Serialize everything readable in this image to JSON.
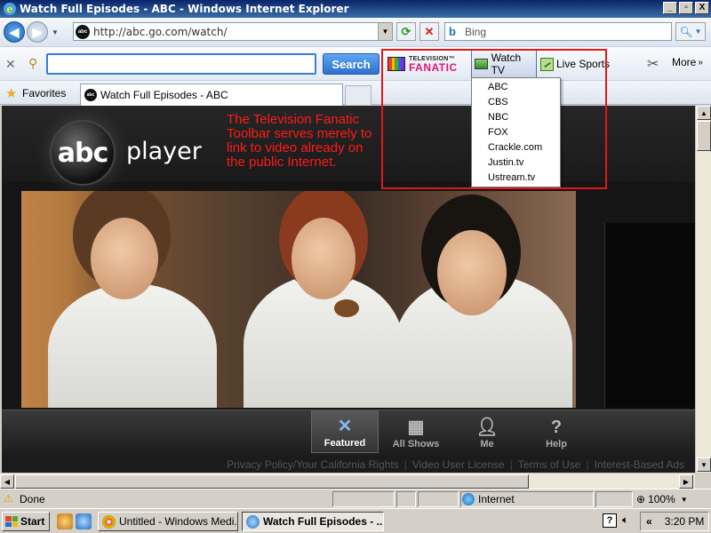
{
  "window": {
    "title": "Watch Full Episodes - ABC - Windows Internet Explorer",
    "minimize": "_",
    "maximize": "▫",
    "close": "X"
  },
  "address_bar": {
    "url": "http://abc.go.com/watch/",
    "site_icon_text": "abc",
    "search_placeholder": "Bing"
  },
  "toolbar": {
    "search_button": "Search",
    "logo_top": "TELEVISION™",
    "logo_bottom": "FANATIC",
    "watch_tv": "Watch TV",
    "live_sports": "Live Sports",
    "more": "More"
  },
  "watch_tv_menu": {
    "items": [
      "ABC",
      "CBS",
      "NBC",
      "FOX",
      "Crackle.com",
      "Justin.tv",
      "Ustream.tv"
    ]
  },
  "favorites_bar": {
    "favorites_label": "Favorites",
    "tab_title": "Watch Full Episodes - ABC"
  },
  "page": {
    "logo_text": "abc",
    "player_text": "player",
    "annotation": "The Television Fanatic Toolbar serves merely to link to video already on the public Internet.",
    "nav": [
      "Featured",
      "All Shows",
      "Me",
      "Help"
    ],
    "footer_links": [
      "Privacy Policy/Your California Rights",
      "Video User License",
      "Terms of Use",
      "Interest-Based Ads"
    ]
  },
  "status_bar": {
    "status": "Done",
    "zone": "Internet",
    "zoom": "100%"
  },
  "taskbar": {
    "start": "Start",
    "tasks": [
      "Untitled - Windows Medi...",
      "Watch Full Episodes - ..."
    ],
    "clock": "3:20 PM"
  },
  "colors": {
    "annotation": "#ff1a1a",
    "highlight_box": "#e01818",
    "logo_pink": "#e0187a",
    "search_blue": "#2d6fcf"
  }
}
